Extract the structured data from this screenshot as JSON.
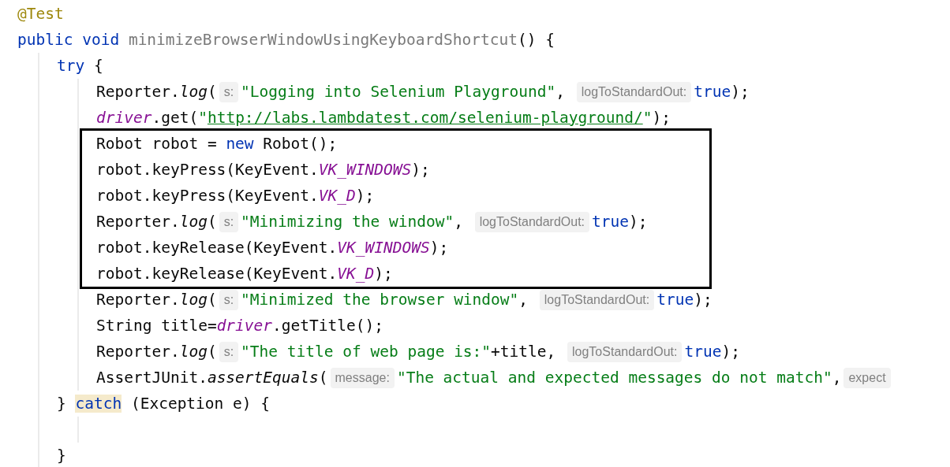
{
  "editor": {
    "lines": [
      {
        "kind": "code",
        "tokens": [
          {
            "kind": "annotation",
            "text": "@Test"
          }
        ]
      },
      {
        "kind": "code",
        "tokens": [
          {
            "kind": "keyword",
            "text": "public void "
          },
          {
            "kind": "unused",
            "text": "minimizeBrowserWindowUsingKeyboardShortcut"
          },
          {
            "kind": "plain",
            "text": "() {"
          }
        ],
        "children": [
          {
            "kind": "code",
            "tokens": [
              {
                "kind": "keyword",
                "text": "try"
              },
              {
                "kind": "plain",
                "text": " {"
              }
            ],
            "children": [
              {
                "kind": "code",
                "tokens": [
                  {
                    "kind": "plain",
                    "text": "Reporter."
                  },
                  {
                    "kind": "static",
                    "text": "log"
                  },
                  {
                    "kind": "plain",
                    "text": "("
                  },
                  {
                    "kind": "hint",
                    "text": "s:"
                  },
                  {
                    "kind": "string",
                    "text": "\"Logging into Selenium Playground\""
                  },
                  {
                    "kind": "plain",
                    "text": ", "
                  },
                  {
                    "kind": "hint",
                    "text": "logToStandardOut:"
                  },
                  {
                    "kind": "keyword",
                    "text": "true"
                  },
                  {
                    "kind": "plain",
                    "text": ");"
                  }
                ]
              },
              {
                "kind": "code",
                "tokens": [
                  {
                    "kind": "field",
                    "text": "driver"
                  },
                  {
                    "kind": "plain",
                    "text": ".get("
                  },
                  {
                    "kind": "string",
                    "text": "\""
                  },
                  {
                    "kind": "url",
                    "text": "http://labs.lambdatest.com/selenium-playground/"
                  },
                  {
                    "kind": "string",
                    "text": "\""
                  },
                  {
                    "kind": "plain",
                    "text": ");"
                  }
                ]
              },
              {
                "kind": "frame",
                "children": [
                  {
                    "kind": "code",
                    "tokens": [
                      {
                        "kind": "plain",
                        "text": "Robot robot = "
                      },
                      {
                        "kind": "keyword",
                        "text": "new"
                      },
                      {
                        "kind": "plain",
                        "text": " Robot();"
                      }
                    ]
                  },
                  {
                    "kind": "code",
                    "tokens": [
                      {
                        "kind": "plain",
                        "text": "robot.keyPress(KeyEvent."
                      },
                      {
                        "kind": "field",
                        "text": "VK_WINDOWS"
                      },
                      {
                        "kind": "plain",
                        "text": ");"
                      }
                    ]
                  },
                  {
                    "kind": "code",
                    "tokens": [
                      {
                        "kind": "plain",
                        "text": "robot.keyPress(KeyEvent."
                      },
                      {
                        "kind": "field",
                        "text": "VK_D"
                      },
                      {
                        "kind": "plain",
                        "text": ");"
                      }
                    ]
                  },
                  {
                    "kind": "code",
                    "tokens": [
                      {
                        "kind": "plain",
                        "text": "Reporter."
                      },
                      {
                        "kind": "static",
                        "text": "log"
                      },
                      {
                        "kind": "plain",
                        "text": "("
                      },
                      {
                        "kind": "hint",
                        "text": "s:"
                      },
                      {
                        "kind": "string",
                        "text": "\"Minimizing the window\""
                      },
                      {
                        "kind": "plain",
                        "text": ", "
                      },
                      {
                        "kind": "hint",
                        "text": "logToStandardOut:"
                      },
                      {
                        "kind": "keyword",
                        "text": "true"
                      },
                      {
                        "kind": "plain",
                        "text": ");"
                      }
                    ]
                  },
                  {
                    "kind": "code",
                    "tokens": [
                      {
                        "kind": "plain",
                        "text": "robot.keyRelease(KeyEvent."
                      },
                      {
                        "kind": "field",
                        "text": "VK_WINDOWS"
                      },
                      {
                        "kind": "plain",
                        "text": ");"
                      }
                    ]
                  },
                  {
                    "kind": "code",
                    "tokens": [
                      {
                        "kind": "plain",
                        "text": "robot.keyRelease(KeyEvent."
                      },
                      {
                        "kind": "field",
                        "text": "VK_D"
                      },
                      {
                        "kind": "plain",
                        "text": ");"
                      }
                    ]
                  }
                ]
              },
              {
                "kind": "code",
                "tokens": [
                  {
                    "kind": "plain",
                    "text": "Reporter."
                  },
                  {
                    "kind": "static",
                    "text": "log"
                  },
                  {
                    "kind": "plain",
                    "text": "("
                  },
                  {
                    "kind": "hint",
                    "text": "s:"
                  },
                  {
                    "kind": "string",
                    "text": "\"Minimized the browser window\""
                  },
                  {
                    "kind": "plain",
                    "text": ", "
                  },
                  {
                    "kind": "hint",
                    "text": "logToStandardOut:"
                  },
                  {
                    "kind": "keyword",
                    "text": "true"
                  },
                  {
                    "kind": "plain",
                    "text": ");"
                  }
                ]
              },
              {
                "kind": "code",
                "tokens": [
                  {
                    "kind": "plain",
                    "text": "String title="
                  },
                  {
                    "kind": "field",
                    "text": "driver"
                  },
                  {
                    "kind": "plain",
                    "text": ".getTitle();"
                  }
                ]
              },
              {
                "kind": "code",
                "tokens": [
                  {
                    "kind": "plain",
                    "text": "Reporter."
                  },
                  {
                    "kind": "static",
                    "text": "log"
                  },
                  {
                    "kind": "plain",
                    "text": "("
                  },
                  {
                    "kind": "hint",
                    "text": "s:"
                  },
                  {
                    "kind": "string",
                    "text": "\"The title of web page is:\""
                  },
                  {
                    "kind": "plain",
                    "text": "+title, "
                  },
                  {
                    "kind": "hint",
                    "text": "logToStandardOut:"
                  },
                  {
                    "kind": "keyword",
                    "text": "true"
                  },
                  {
                    "kind": "plain",
                    "text": ");"
                  }
                ]
              },
              {
                "kind": "code",
                "tokens": [
                  {
                    "kind": "plain",
                    "text": "AssertJUnit."
                  },
                  {
                    "kind": "static",
                    "text": "assertEquals"
                  },
                  {
                    "kind": "plain",
                    "text": "("
                  },
                  {
                    "kind": "hint",
                    "text": "message:"
                  },
                  {
                    "kind": "string",
                    "text": "\"The actual and expected messages do not match\""
                  },
                  {
                    "kind": "plain",
                    "text": ","
                  },
                  {
                    "kind": "hint",
                    "text": "expect"
                  }
                ]
              }
            ]
          },
          {
            "kind": "code",
            "tokens": [
              {
                "kind": "plain",
                "text": "} "
              },
              {
                "kind": "match",
                "text": "catch"
              },
              {
                "kind": "plain",
                "text": " (Exception e) {"
              }
            ],
            "children": [
              {
                "kind": "blank"
              }
            ]
          },
          {
            "kind": "code",
            "tokens": [
              {
                "kind": "plain",
                "text": "}"
              }
            ]
          }
        ]
      }
    ]
  }
}
